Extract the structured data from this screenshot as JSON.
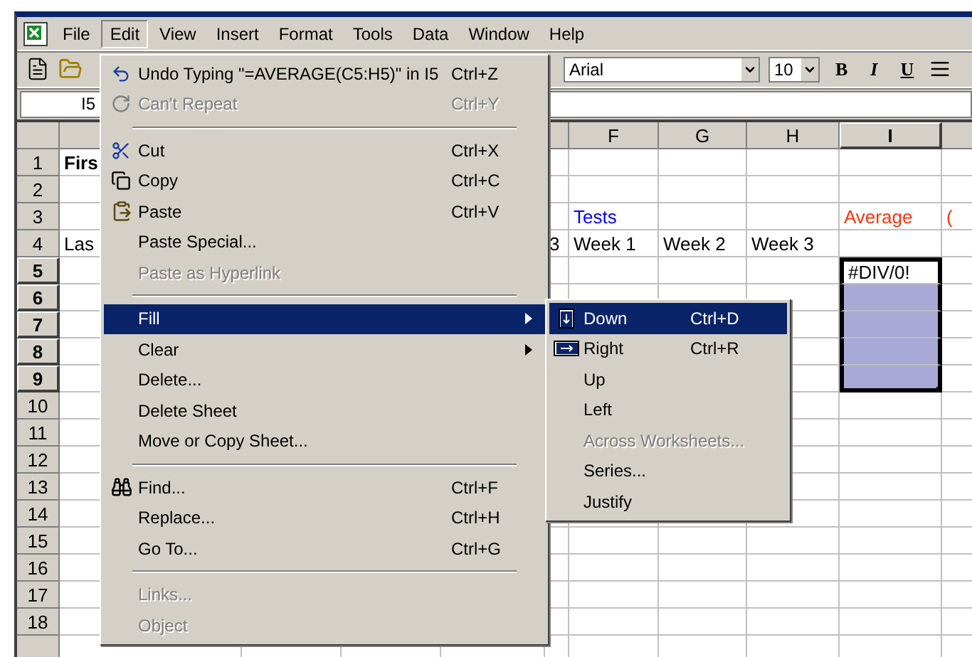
{
  "menubar": [
    {
      "label": "File",
      "selected": false
    },
    {
      "label": "Edit",
      "selected": true
    },
    {
      "label": "View",
      "selected": false
    },
    {
      "label": "Insert",
      "selected": false
    },
    {
      "label": "Format",
      "selected": false
    },
    {
      "label": "Tools",
      "selected": false
    },
    {
      "label": "Data",
      "selected": false
    },
    {
      "label": "Window",
      "selected": false
    },
    {
      "label": "Help",
      "selected": false
    }
  ],
  "toolbar": {
    "font": "Arial",
    "size": "10",
    "format_buttons": [
      "B",
      "I",
      "U"
    ]
  },
  "name_box": "I5",
  "columns": [
    {
      "label": "F",
      "selected": false
    },
    {
      "label": "G",
      "selected": false
    },
    {
      "label": "H",
      "selected": false
    },
    {
      "label": "I",
      "selected": true
    }
  ],
  "rows": [
    {
      "number": "1",
      "selected": false,
      "cells": [
        {
          "text": "Firs",
          "bold": true
        },
        null,
        null,
        null,
        null,
        null,
        null,
        null,
        null,
        null
      ]
    },
    {
      "number": "2",
      "selected": false,
      "cells": []
    },
    {
      "number": "3",
      "selected": false,
      "cells": [
        null,
        null,
        null,
        null,
        null,
        {
          "text": "Tests",
          "color": "#0000ff"
        },
        null,
        null,
        {
          "text": "Average",
          "color": "#ff3300"
        },
        {
          "text": "(",
          "color": "#ff3300"
        }
      ]
    },
    {
      "number": "4",
      "selected": false,
      "cells": [
        {
          "text": "Las"
        },
        null,
        null,
        null,
        {
          "text": "3"
        },
        {
          "text": "Week 1"
        },
        {
          "text": "Week 2"
        },
        {
          "text": "Week 3"
        },
        null,
        null
      ]
    },
    {
      "number": "5",
      "selected": true,
      "cells": [
        null,
        null,
        null,
        null,
        null,
        null,
        null,
        null,
        {
          "text": "#DIV/0!",
          "selected": true,
          "active": true
        },
        null
      ]
    },
    {
      "number": "6",
      "selected": true,
      "cells": [
        null,
        null,
        null,
        null,
        null,
        null,
        null,
        null,
        {
          "selected": true,
          "active": false
        },
        null
      ]
    },
    {
      "number": "7",
      "selected": true,
      "cells": [
        null,
        null,
        null,
        null,
        null,
        null,
        null,
        null,
        {
          "selected": true,
          "active": false
        },
        null
      ]
    },
    {
      "number": "8",
      "selected": true,
      "cells": [
        null,
        null,
        null,
        null,
        null,
        null,
        null,
        null,
        {
          "selected": true,
          "active": false
        },
        null
      ]
    },
    {
      "number": "9",
      "selected": true,
      "cells": [
        null,
        null,
        null,
        null,
        null,
        null,
        null,
        null,
        {
          "selected": true,
          "active": false
        },
        null
      ]
    },
    {
      "number": "10",
      "selected": false,
      "cells": []
    },
    {
      "number": "11",
      "selected": false,
      "cells": []
    },
    {
      "number": "12",
      "selected": false,
      "cells": []
    },
    {
      "number": "13",
      "selected": false,
      "cells": []
    },
    {
      "number": "14",
      "selected": false,
      "cells": []
    },
    {
      "number": "15",
      "selected": false,
      "cells": []
    },
    {
      "number": "16",
      "selected": false,
      "cells": []
    },
    {
      "number": "17",
      "selected": false,
      "cells": []
    },
    {
      "number": "18",
      "selected": false,
      "cells": []
    },
    {
      "selected": false,
      "cells": []
    }
  ],
  "edit_menu": [
    {
      "kind": "command",
      "label": "Undo Typing \"=AVERAGE(C5:H5)\" in I5",
      "shortcut": "Ctrl+Z",
      "disabled": false,
      "selected": false
    },
    {
      "kind": "command",
      "label": "Can't Repeat",
      "shortcut": "Ctrl+Y",
      "disabled": true,
      "selected": false
    },
    {
      "kind": "separator"
    },
    {
      "kind": "command",
      "label": "Cut",
      "shortcut": "Ctrl+X",
      "disabled": false,
      "selected": false
    },
    {
      "kind": "command",
      "label": "Copy",
      "shortcut": "Ctrl+C",
      "disabled": false,
      "selected": false
    },
    {
      "kind": "command",
      "label": "Paste",
      "shortcut": "Ctrl+V",
      "disabled": false,
      "selected": false
    },
    {
      "kind": "command",
      "label": "Paste Special...",
      "disabled": false,
      "selected": false
    },
    {
      "kind": "command",
      "label": "Paste as Hyperlink",
      "disabled": true,
      "selected": false
    },
    {
      "kind": "separator"
    },
    {
      "kind": "submenu",
      "label": "Fill",
      "disabled": false,
      "selected": true
    },
    {
      "kind": "submenu",
      "label": "Clear",
      "disabled": false,
      "selected": false
    },
    {
      "kind": "command",
      "label": "Delete...",
      "disabled": false,
      "selected": false
    },
    {
      "kind": "command",
      "label": "Delete Sheet",
      "disabled": false,
      "selected": false
    },
    {
      "kind": "command",
      "label": "Move or Copy Sheet...",
      "disabled": false,
      "selected": false
    },
    {
      "kind": "separator"
    },
    {
      "kind": "command",
      "label": "Find...",
      "shortcut": "Ctrl+F",
      "disabled": false,
      "selected": false
    },
    {
      "kind": "command",
      "label": "Replace...",
      "shortcut": "Ctrl+H",
      "disabled": false,
      "selected": false
    },
    {
      "kind": "command",
      "label": "Go To...",
      "shortcut": "Ctrl+G",
      "disabled": false,
      "selected": false
    },
    {
      "kind": "separator"
    },
    {
      "kind": "command",
      "label": "Links...",
      "disabled": true,
      "selected": false
    },
    {
      "kind": "command",
      "label": "Object",
      "disabled": true,
      "selected": false
    }
  ],
  "fill_submenu": [
    {
      "kind": "command",
      "label": "Down",
      "shortcut": "Ctrl+D",
      "disabled": false,
      "selected": true
    },
    {
      "kind": "command",
      "label": "Right",
      "shortcut": "Ctrl+R",
      "disabled": false,
      "selected": false
    },
    {
      "kind": "command",
      "label": "Up",
      "disabled": false,
      "selected": false
    },
    {
      "kind": "command",
      "label": "Left",
      "disabled": false,
      "selected": false
    },
    {
      "kind": "command",
      "label": "Across Worksheets...",
      "disabled": true,
      "selected": false
    },
    {
      "kind": "command",
      "label": "Series...",
      "disabled": false,
      "selected": false
    },
    {
      "kind": "command",
      "label": "Justify",
      "disabled": false,
      "selected": false
    }
  ]
}
